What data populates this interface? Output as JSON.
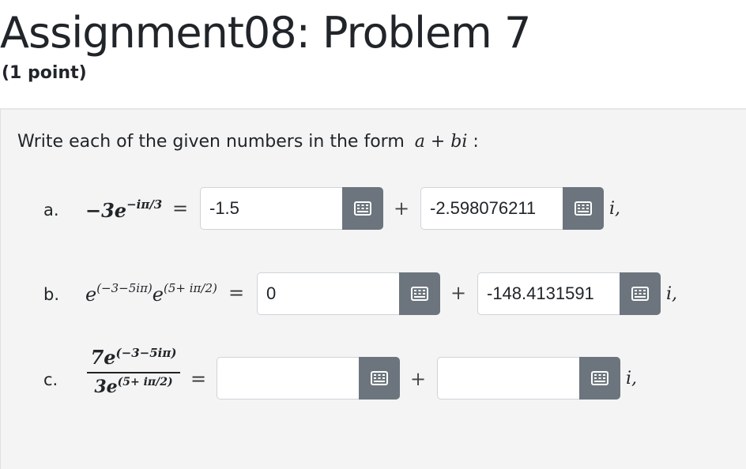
{
  "header": {
    "title": "Assignment08: Problem 7",
    "points": "(1 point)"
  },
  "intro": {
    "text": "Write each of the given numbers in the form",
    "form": "a + bi",
    "colon": ":"
  },
  "parts": [
    {
      "label": "a.",
      "expr_base": "−3e",
      "expr_exp": "−iπ/3",
      "equals": "=",
      "real_value": "-1.5",
      "plus": "+",
      "imag_value": "-2.598076211",
      "i_suffix": "i,"
    },
    {
      "label": "b.",
      "expr_e1": "e",
      "expr_exp1": "(−3−5iπ)",
      "expr_e2": "e",
      "expr_exp2": "(5+ iπ/2)",
      "equals": "=",
      "real_value": "0",
      "plus": "+",
      "imag_value": "-148.4131591",
      "i_suffix": "i,"
    },
    {
      "label": "c.",
      "num_base": "7e",
      "num_exp": "(−3−5iπ)",
      "den_base": "3e",
      "den_exp": "(5+ iπ/2)",
      "equals": "=",
      "real_value": "",
      "plus": "+",
      "imag_value": "",
      "i_suffix": "i,"
    }
  ],
  "icons": {
    "keyboard": "keyboard-icon"
  },
  "colors": {
    "button_bg": "#6c757d",
    "panel_bg": "#f4f4f4"
  }
}
